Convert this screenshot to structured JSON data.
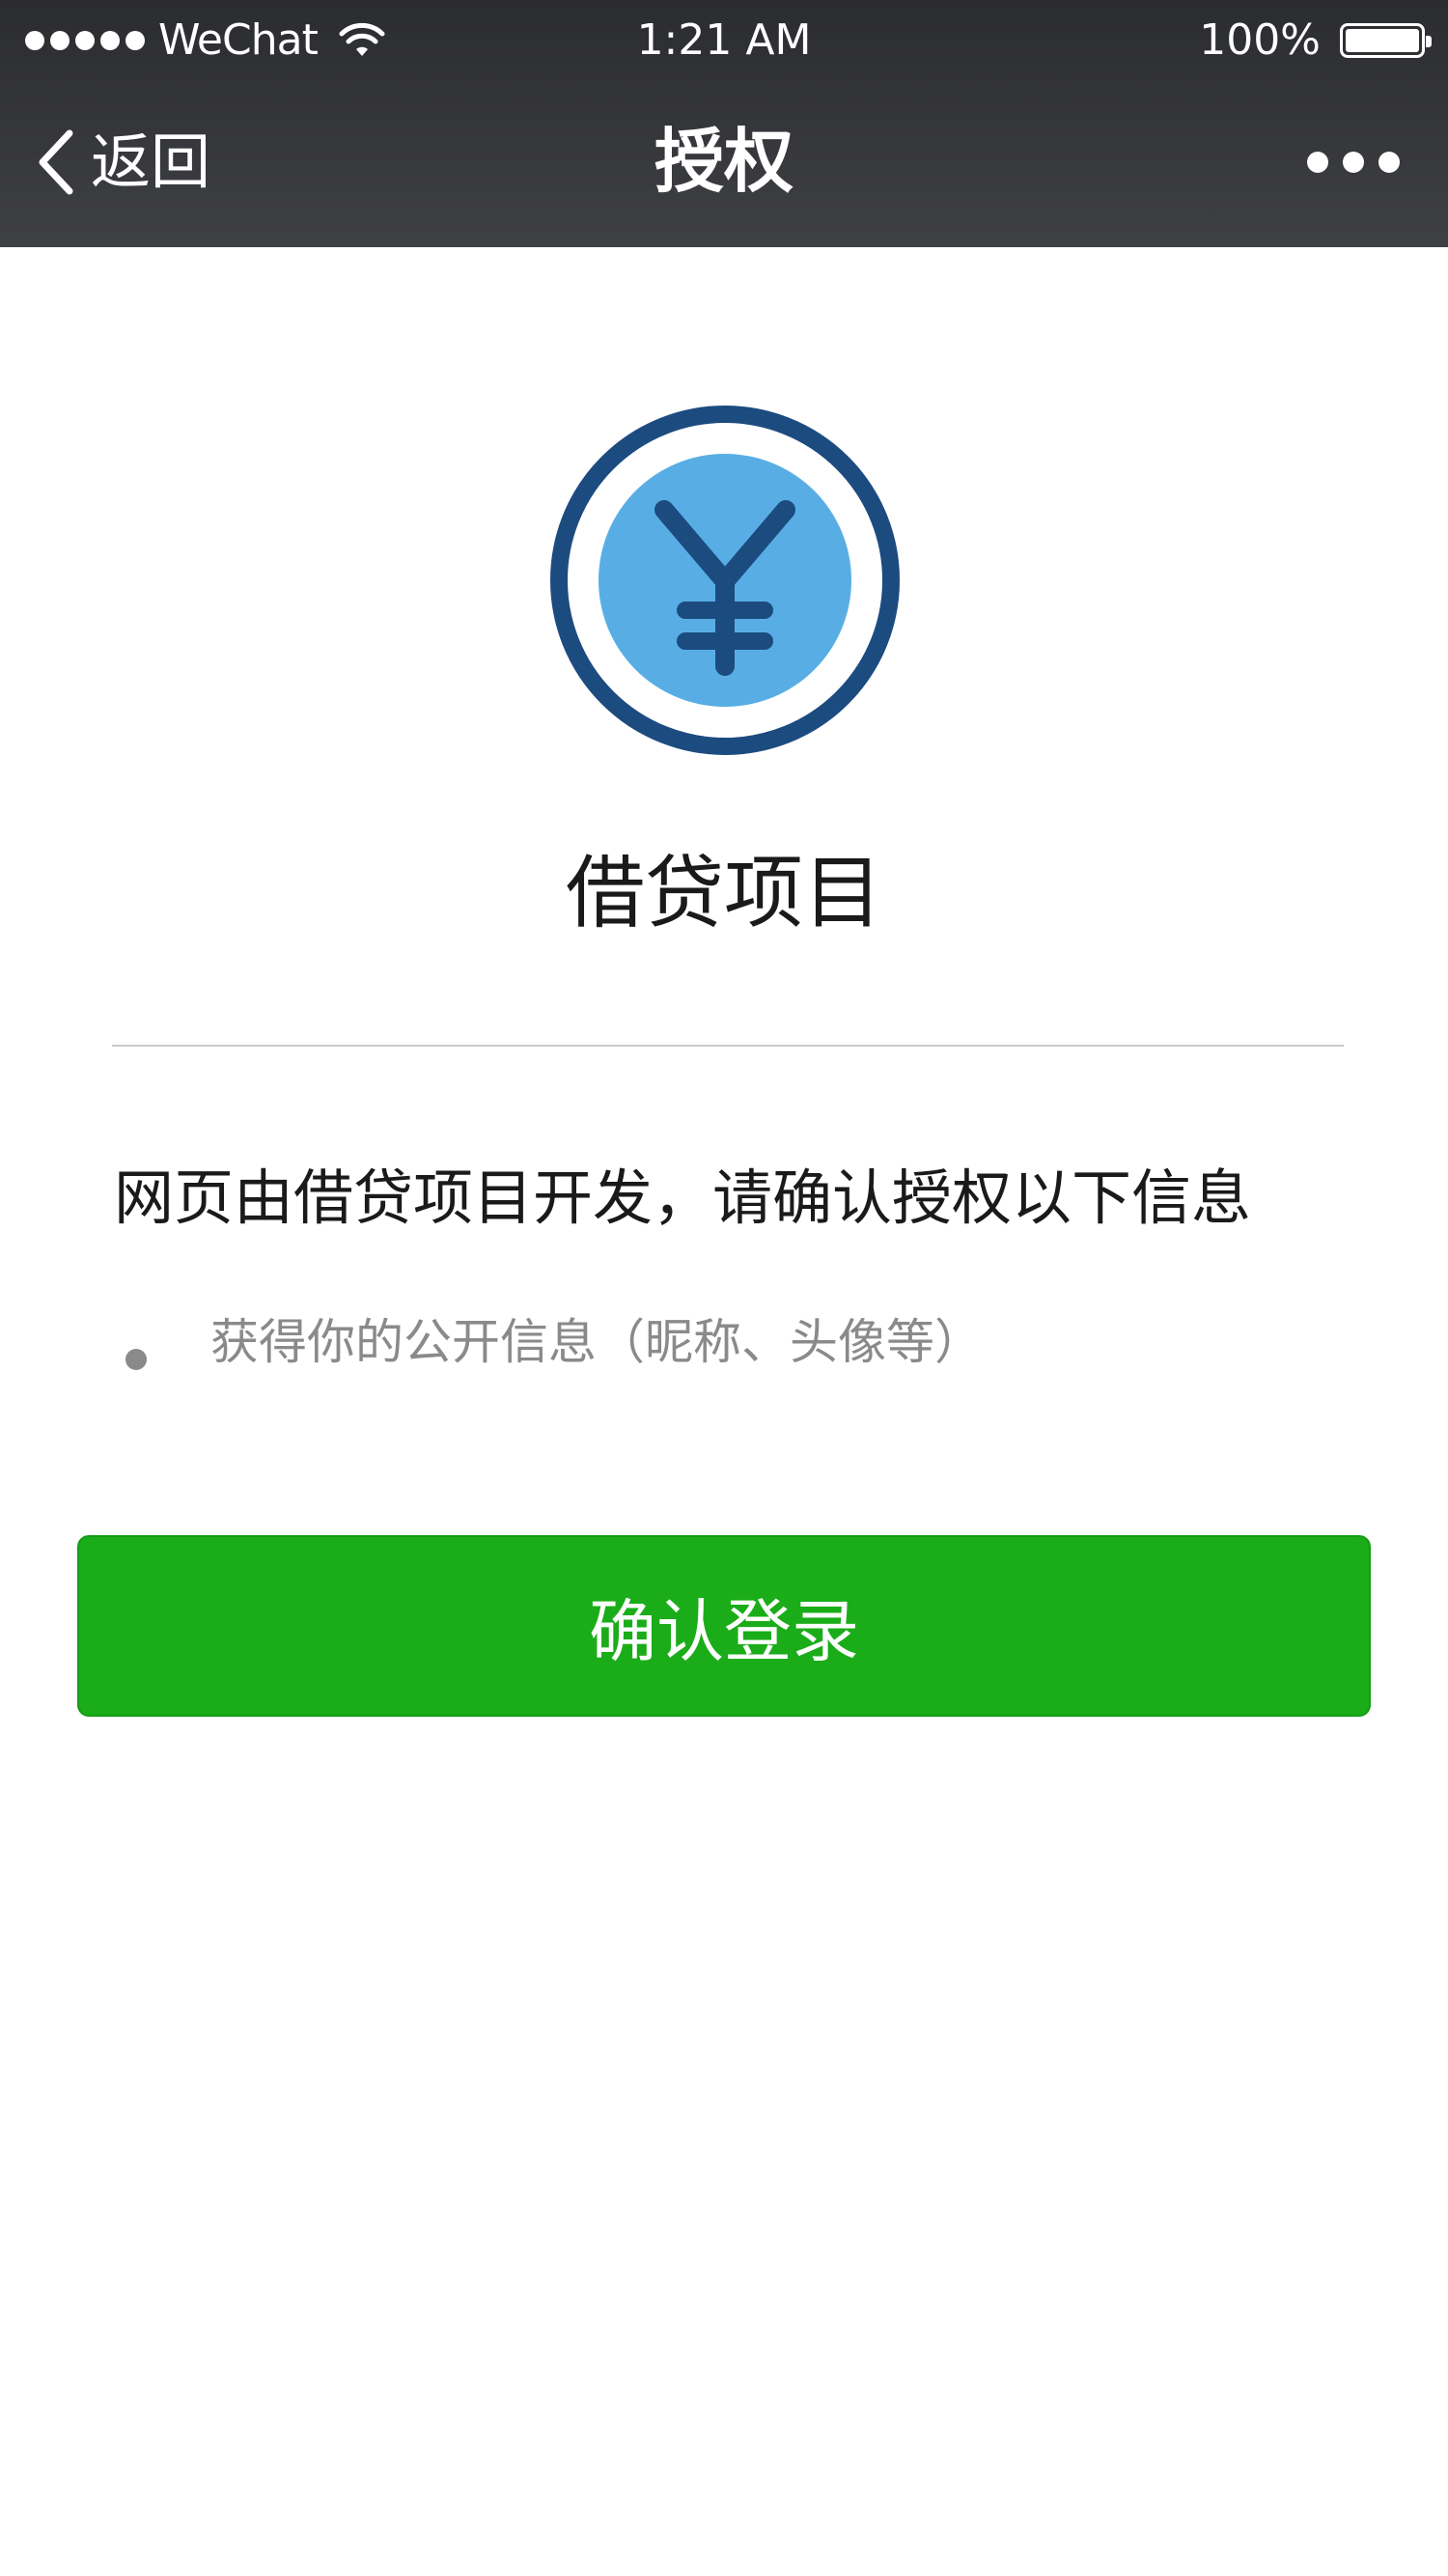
{
  "status_bar": {
    "carrier": "WeChat",
    "time": "1:21 AM",
    "battery_percent": "100%",
    "battery_level": 1.0
  },
  "nav": {
    "back_label": "返回",
    "title": "授权"
  },
  "app": {
    "icon": "yen-coin-icon",
    "name": "借贷项目"
  },
  "notice": "网页由借贷项目开发，请确认授权以下信息",
  "permissions": [
    "获得你的公开信息（昵称、头像等）"
  ],
  "confirm_button": "确认登录",
  "colors": {
    "nav_background": "#2b2c30",
    "confirm_green": "#1aad19",
    "logo_dark_blue": "#1c4b80",
    "logo_light_blue": "#58aee4",
    "secondary_text": "#8a8a8a"
  }
}
